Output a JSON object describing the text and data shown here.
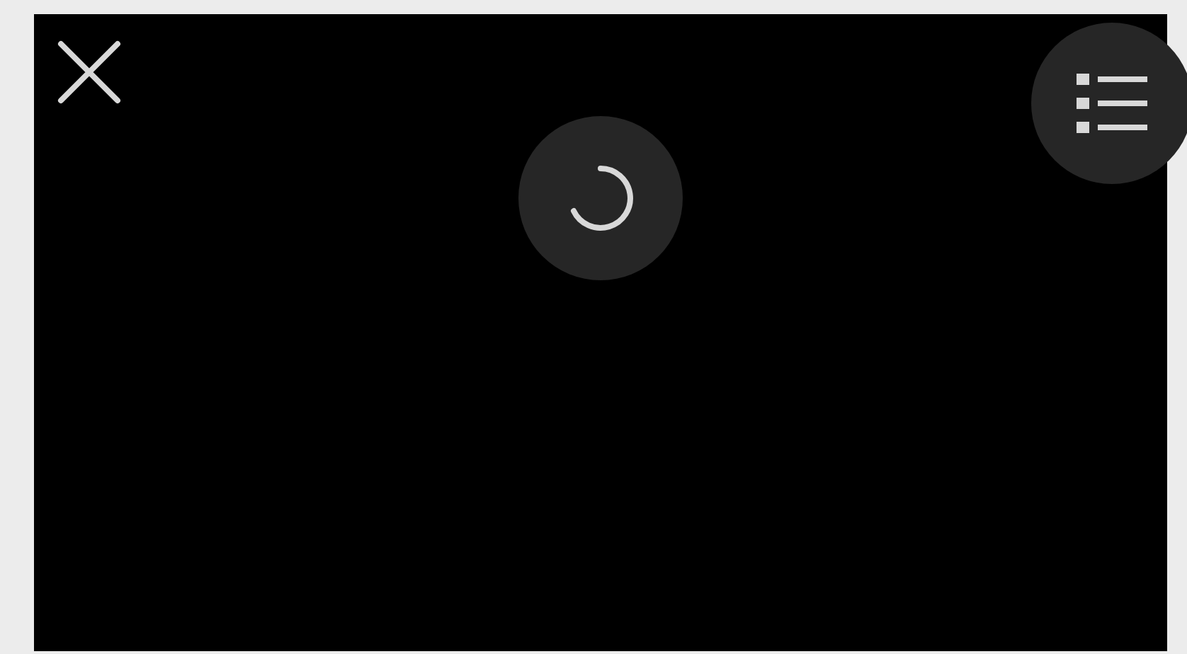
{
  "viewer": {
    "loading": true
  }
}
